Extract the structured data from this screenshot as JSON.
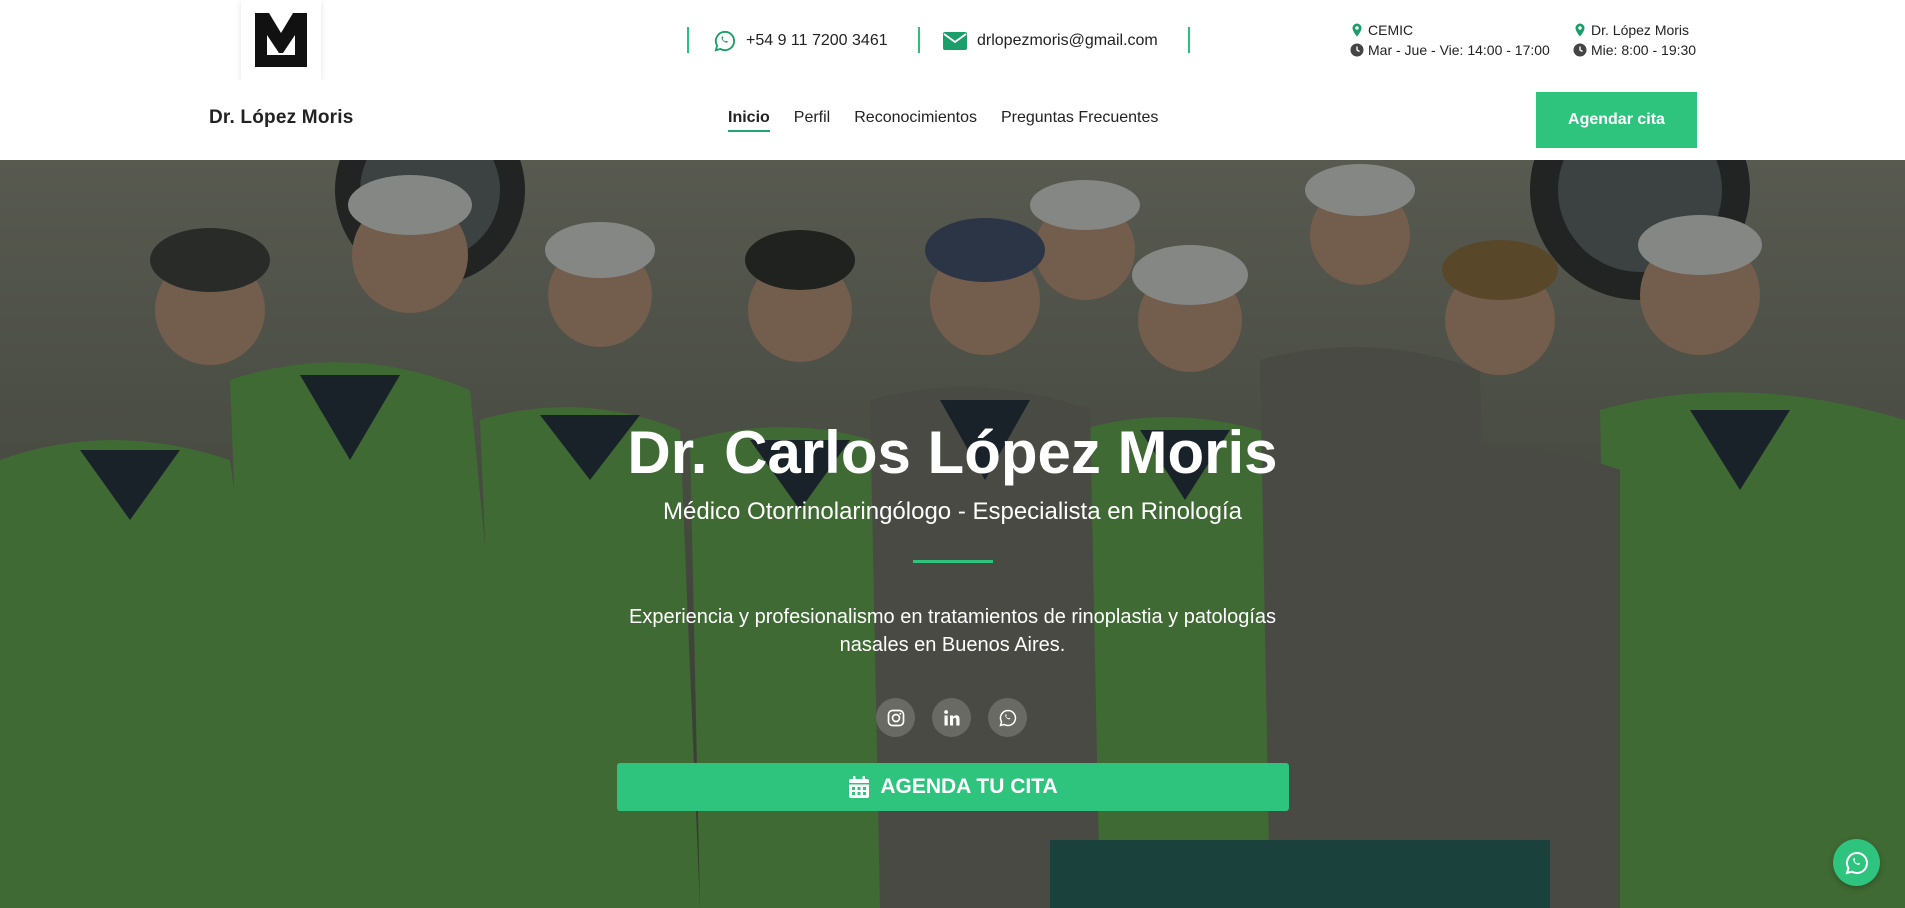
{
  "header": {
    "logo_alt": "LM logo",
    "phone": "+54 9 11 7200 3461",
    "email": "drlopezmoris@gmail.com",
    "locations": [
      {
        "name": "CEMIC",
        "hours": "Mar - Jue - Vie: 14:00 - 17:00"
      },
      {
        "name": "Dr. López Moris",
        "hours": "Mie: 8:00 - 19:30"
      }
    ]
  },
  "nav": {
    "brand": "Dr. López Moris",
    "items": [
      "Inicio",
      "Perfil",
      "Reconocimientos",
      "Preguntas Frecuentes"
    ],
    "active": "Inicio",
    "cta": "Agendar cita"
  },
  "hero": {
    "title": "Dr. Carlos López Moris",
    "subtitle": "Médico Otorrinolaringólogo - Especialista en Rinología",
    "description": "Experiencia y profesionalismo en tratamientos de rinoplastia y patologías nasales en Buenos Aires.",
    "socials": [
      "instagram-icon",
      "linkedin-icon",
      "whatsapp-icon"
    ],
    "cta": "AGENDA TU CITA"
  },
  "colors": {
    "accent": "#2ec47e",
    "text": "#222222",
    "hero_overlay": "#1c2019"
  }
}
